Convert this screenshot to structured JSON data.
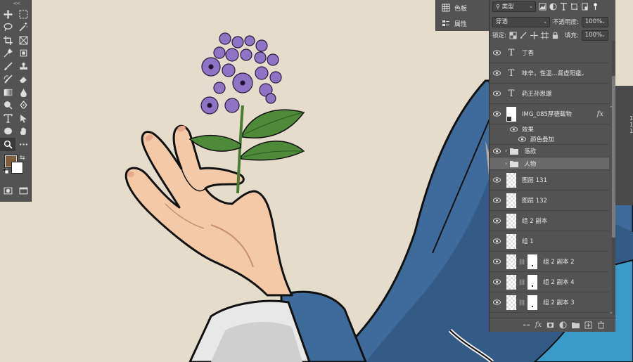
{
  "mini_panel": {
    "swatches_label": "色板",
    "properties_label": "属性"
  },
  "layers_panel": {
    "filter_kind": "类型",
    "blend_mode": "穿透",
    "opacity_label": "不透明度:",
    "opacity_value": "100%",
    "lock_label": "锁定:",
    "fill_label": "填充:",
    "fill_value": "100%",
    "rows": [
      {
        "type": "text",
        "name": "丁香"
      },
      {
        "type": "text",
        "name": "味辛，性温...肾虚阳痿。"
      },
      {
        "type": "text",
        "name": "药王孙思邈"
      },
      {
        "type": "smart",
        "name": "IMG_085厚德载物",
        "fx": "fx"
      },
      {
        "type": "effects",
        "name": "效果"
      },
      {
        "type": "effect",
        "name": "颜色叠加"
      },
      {
        "type": "group",
        "name": "落款"
      },
      {
        "type": "group",
        "name": "人物",
        "selected": true
      },
      {
        "type": "pixel",
        "name": "图层 131"
      },
      {
        "type": "pixel",
        "name": "图层 132"
      },
      {
        "type": "pixel",
        "name": "组 2 副本"
      },
      {
        "type": "pixel",
        "name": "组 1"
      },
      {
        "type": "masked",
        "name": "组 2 副本 2"
      },
      {
        "type": "masked",
        "name": "组 2 副本 4"
      },
      {
        "type": "masked",
        "name": "组 2 副本 3"
      }
    ],
    "footer_fx": "fx"
  },
  "colors": {
    "canvas_bg": "#e5dccb",
    "panel_bg": "#535353",
    "foreground_color": "#7f5e3f",
    "background_color": "#ffffff",
    "robe_blue": "#3f6b9c",
    "lilac": "#8f73c4",
    "leaf": "#4e8a3a",
    "skin": "#f3c9a8"
  },
  "side_numbers": [
    "1",
    "1",
    "1"
  ]
}
